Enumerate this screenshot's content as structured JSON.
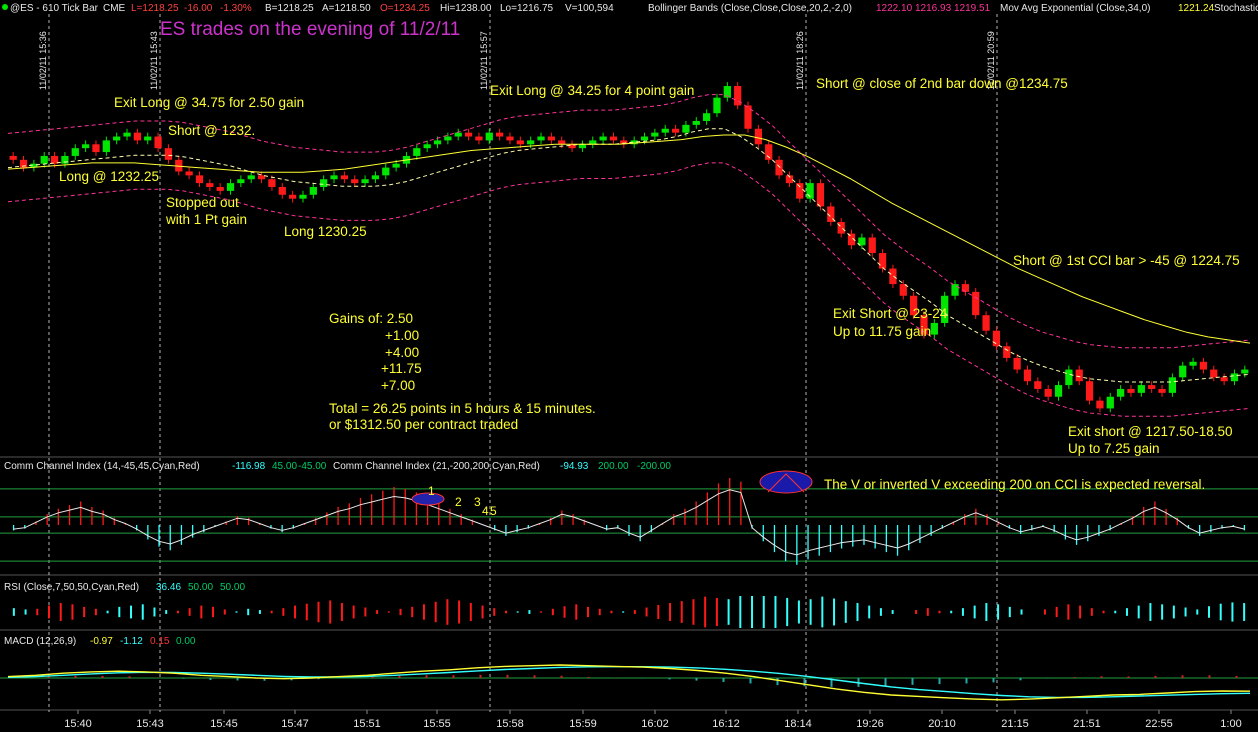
{
  "header": {
    "symbol": "@ES - 610 Tick Bar",
    "exchange": "CME",
    "last": "L=1218.25",
    "change": "-16.00",
    "change_pct": "-1.30%",
    "bid": "B=1218.25",
    "ask": "A=1218.50",
    "open": "O=1234.25",
    "high": "Hi=1238.00",
    "low": "Lo=1216.75",
    "volume": "V=100,594",
    "bb_label": "Bollinger Bands (Close,Close,Close,20,2,-2,0)",
    "bb_values": [
      "1222.10",
      "1216.93",
      "1219.51"
    ],
    "ema_label": "Mov Avg Exponential (Close,34,0)",
    "ema_value": "1221.24",
    "stoch_label": "Stochastic"
  },
  "colors": {
    "up": "#00e600",
    "down": "#ff1a1a",
    "bb": "#ff3399",
    "ema": "#ffff33",
    "cyan": "#33ffff",
    "orange": "#ffcc00",
    "magenta": "#ff33cc"
  },
  "chart_data": [
    {
      "type": "candlestick",
      "title": "ES trades on the evening of 11/2/11",
      "series_name": "@ES 610 Tick Bar",
      "ylim": [
        1214,
        1242
      ],
      "x_tick_labels": [
        "15:40",
        "15:43",
        "15:45",
        "15:47",
        "15:51",
        "15:55",
        "15:58",
        "15:59",
        "16:02",
        "16:12",
        "18:14",
        "19:26",
        "20:10",
        "21:15",
        "21:51",
        "22:55",
        "1:00"
      ],
      "separator_dates": [
        "11/02/11 15:36",
        "11/02/11 15:43",
        "11/02/11 15:57",
        "11/02/11 18:26",
        "11/02/11 20:59"
      ],
      "close": [
        1233.0,
        1232.5,
        1232.75,
        1233.25,
        1232.75,
        1233.25,
        1233.75,
        1234.0,
        1233.5,
        1234.25,
        1234.5,
        1234.75,
        1234.25,
        1234.5,
        1233.75,
        1233.0,
        1232.25,
        1232.0,
        1231.5,
        1231.25,
        1231.0,
        1231.5,
        1231.75,
        1232.0,
        1231.75,
        1231.25,
        1230.75,
        1230.5,
        1230.75,
        1231.25,
        1231.75,
        1232.0,
        1231.75,
        1231.5,
        1231.75,
        1232.0,
        1232.5,
        1232.75,
        1233.25,
        1233.75,
        1234.0,
        1234.25,
        1234.5,
        1234.75,
        1234.5,
        1234.25,
        1234.75,
        1234.5,
        1234.25,
        1234.0,
        1234.25,
        1234.5,
        1234.25,
        1234.0,
        1233.75,
        1234.0,
        1234.25,
        1234.5,
        1234.25,
        1234.0,
        1234.25,
        1234.5,
        1234.75,
        1235.0,
        1234.75,
        1235.25,
        1235.5,
        1236.0,
        1237.0,
        1237.75,
        1236.5,
        1235.0,
        1234.0,
        1233.0,
        1232.0,
        1231.5,
        1230.5,
        1231.5,
        1230.0,
        1229.0,
        1228.25,
        1227.5,
        1228.0,
        1227.0,
        1226.0,
        1225.0,
        1224.25,
        1223.0,
        1221.75,
        1222.5,
        1224.25,
        1225.0,
        1224.5,
        1223.0,
        1222.0,
        1221.0,
        1220.25,
        1219.5,
        1218.75,
        1218.25,
        1217.75,
        1218.5,
        1219.5,
        1218.75,
        1217.5,
        1217.0,
        1217.75,
        1218.25,
        1218.0,
        1218.5,
        1218.25,
        1218.0,
        1219.0,
        1219.75,
        1220.0,
        1219.5,
        1219.0,
        1218.75,
        1219.25,
        1219.5
      ],
      "bollinger_basis": [
        1232.5,
        1232.6,
        1232.7,
        1232.8,
        1232.9,
        1233.0,
        1233.1,
        1233.2,
        1233.3,
        1233.3,
        1233.3,
        1233.2,
        1233.0,
        1232.8,
        1232.6,
        1232.3,
        1232.0,
        1231.8,
        1231.6,
        1231.5,
        1231.4,
        1231.3,
        1231.3,
        1231.3,
        1231.4,
        1231.6,
        1231.9,
        1232.2,
        1232.5,
        1232.8,
        1233.1,
        1233.4,
        1233.6,
        1233.7,
        1233.8,
        1233.9,
        1234.0,
        1234.0,
        1234.0,
        1234.1,
        1234.2,
        1234.3,
        1234.5,
        1234.8,
        1235.0,
        1235.0,
        1234.5,
        1233.8,
        1233.0,
        1232.0,
        1231.0,
        1230.0,
        1229.0,
        1228.0,
        1227.0,
        1226.0,
        1225.2,
        1224.5,
        1223.8,
        1223.0,
        1222.4,
        1221.8,
        1221.2,
        1220.6,
        1220.1,
        1219.7,
        1219.4,
        1219.1,
        1218.9,
        1218.8,
        1218.7,
        1218.7,
        1218.7,
        1218.7,
        1218.8,
        1218.9,
        1219.0,
        1219.1,
        1219.2
      ],
      "ema34": [
        1232.4,
        1232.5,
        1232.6,
        1232.7,
        1232.8,
        1232.8,
        1232.8,
        1232.7,
        1232.6,
        1232.5,
        1232.4,
        1232.3,
        1232.2,
        1232.2,
        1232.2,
        1232.3,
        1232.4,
        1232.6,
        1232.8,
        1233.0,
        1233.2,
        1233.4,
        1233.6,
        1233.7,
        1233.8,
        1233.9,
        1234.0,
        1234.0,
        1234.0,
        1234.0,
        1234.1,
        1234.2,
        1234.3,
        1234.5,
        1234.6,
        1234.6,
        1234.3,
        1233.8,
        1233.2,
        1232.5,
        1231.8,
        1231.0,
        1230.2,
        1229.5,
        1228.8,
        1228.1,
        1227.4,
        1226.7,
        1226.0,
        1225.4,
        1224.8,
        1224.2,
        1223.7,
        1223.2,
        1222.7,
        1222.3,
        1221.9,
        1221.6,
        1221.4,
        1221.2
      ],
      "annotations": [
        {
          "text": "Exit Long @ 34.75 for 2.50 gain",
          "color": "#ffff33"
        },
        {
          "text": "Short @ 1232.",
          "color": "#ffff33"
        },
        {
          "text": "Long @ 1232.25",
          "color": "#ffff33"
        },
        {
          "text": "Stopped out",
          "color": "#ffff33"
        },
        {
          "text": "with 1 Pt gain",
          "color": "#ffff33"
        },
        {
          "text": "Long 1230.25",
          "color": "#ffff33"
        },
        {
          "text": "Exit Long @ 34.25 for 4 point gain",
          "color": "#ffff33"
        },
        {
          "text": "Short @ close of 2nd bar down @1234.75",
          "color": "#ffff33"
        },
        {
          "text": "Short @ 1st CCI bar > -45 @ 1224.75",
          "color": "#ffff33"
        },
        {
          "text": "Exit Short @ 23-24",
          "color": "#ffff33"
        },
        {
          "text": "Up to 11.75 gain",
          "color": "#ffff33"
        },
        {
          "text": "Exit short @ 1217.50-18.50",
          "color": "#ffff33"
        },
        {
          "text": "Up to 7.25 gain",
          "color": "#ffff33"
        },
        {
          "text": "Gains of:  2.50",
          "color": "#ffff33"
        },
        {
          "text": "+1.00",
          "color": "#ffff33"
        },
        {
          "text": "+4.00",
          "color": "#ffff33"
        },
        {
          "text": "+11.75",
          "color": "#ffff33"
        },
        {
          "text": "+7.00",
          "color": "#ffff33"
        },
        {
          "text": "Total  = 26.25 points in 5 hours & 15 minutes.",
          "color": "#ffff33"
        },
        {
          "text": "or $1312.50 per contract traded",
          "color": "#ffff33"
        }
      ]
    },
    {
      "type": "histogram",
      "panel": "CCI",
      "labels": [
        {
          "text": "Comm Channel Index (14,-45,45,Cyan,Red)",
          "color": "#e8e8e8"
        },
        {
          "text": "-116.98",
          "color": "#33ffff"
        },
        {
          "text": "45.00",
          "color": "#00cc66"
        },
        {
          "text": "-45.00",
          "color": "#00cc66"
        },
        {
          "text": "Comm Channel Index (21,-200,200,Cyan,Red)",
          "color": "#e8e8e8"
        },
        {
          "text": "-94.93",
          "color": "#33ffff"
        },
        {
          "text": "200.00",
          "color": "#00cc66"
        },
        {
          "text": "-200.00",
          "color": "#00cc66"
        }
      ],
      "levels": [
        200,
        45,
        -45,
        -200
      ],
      "ylim": [
        -260,
        260
      ],
      "annotation": "The V or inverted V exceeding 200 on CCI is expected reversal.",
      "count_labels": [
        "1",
        "2",
        "3",
        "4",
        "5"
      ],
      "values": [
        -30,
        -20,
        20,
        60,
        90,
        110,
        130,
        100,
        80,
        40,
        10,
        -30,
        -80,
        -120,
        -140,
        -110,
        -70,
        -40,
        -10,
        20,
        50,
        40,
        10,
        -20,
        -40,
        -20,
        10,
        40,
        70,
        100,
        120,
        150,
        170,
        190,
        210,
        200,
        180,
        150,
        120,
        90,
        60,
        30,
        0,
        -30,
        -60,
        -40,
        -20,
        10,
        40,
        80,
        60,
        30,
        0,
        -30,
        -20,
        -60,
        -90,
        -40,
        10,
        60,
        90,
        130,
        180,
        230,
        260,
        240,
        -20,
        -90,
        -150,
        -200,
        -220,
        -190,
        -170,
        -150,
        -130,
        -120,
        -110,
        -130,
        -150,
        -170,
        -140,
        -100,
        -60,
        -20,
        20,
        60,
        90,
        60,
        20,
        -20,
        -50,
        -30,
        -10,
        -40,
        -80,
        -110,
        -90,
        -60,
        -30,
        10,
        50,
        100,
        130,
        90,
        40,
        -20,
        -60,
        -40,
        -20,
        -10,
        -30
      ]
    },
    {
      "type": "histogram",
      "panel": "RSI",
      "labels": [
        {
          "text": "RSI (Close,7,50,50,Cyan,Red)",
          "color": "#e8e8e8"
        },
        {
          "text": "36.46",
          "color": "#33ffff"
        },
        {
          "text": "50.00",
          "color": "#00cc66"
        },
        {
          "text": "50.00",
          "color": "#00cc66"
        }
      ],
      "ylim": [
        0,
        100
      ],
      "values": [
        44,
        46,
        55,
        60,
        64,
        62,
        58,
        55,
        48,
        42,
        40,
        38,
        43,
        47,
        52,
        56,
        60,
        58,
        54,
        49,
        45,
        47,
        52,
        56,
        60,
        63,
        66,
        68,
        64,
        60,
        57,
        53,
        51,
        55,
        58,
        62,
        66,
        70,
        68,
        64,
        60,
        56,
        52,
        49,
        47,
        51,
        55,
        59,
        62,
        58,
        55,
        52,
        49,
        53,
        57,
        61,
        64,
        67,
        70,
        74,
        72,
        30,
        25,
        22,
        20,
        24,
        28,
        32,
        30,
        26,
        29,
        33,
        36,
        40,
        44,
        47,
        50,
        53,
        56,
        52,
        48,
        44,
        40,
        36,
        38,
        42,
        46,
        50,
        54,
        58,
        62,
        60,
        56,
        52,
        48,
        44,
        40,
        36,
        38,
        40,
        43,
        46,
        41,
        37,
        35,
        36
      ]
    },
    {
      "type": "line",
      "panel": "MACD",
      "labels": [
        {
          "text": "MACD (12,26,9)",
          "color": "#e8e8e8"
        },
        {
          "text": "-0.97",
          "color": "#ffff33"
        },
        {
          "text": "-1.12",
          "color": "#33ffff"
        },
        {
          "text": "0.15",
          "color": "#ff3333"
        },
        {
          "text": "0.00",
          "color": "#00cc66"
        }
      ],
      "ylim": [
        -2.2,
        2.2
      ],
      "macd": [
        0.1,
        0.2,
        0.35,
        0.45,
        0.5,
        0.45,
        0.35,
        0.2,
        0.1,
        0.0,
        -0.05,
        0.0,
        0.1,
        0.2,
        0.35,
        0.5,
        0.6,
        0.75,
        0.85,
        0.9,
        0.95,
        0.9,
        0.85,
        0.8,
        0.7,
        0.55,
        0.35,
        0.1,
        -0.2,
        -0.5,
        -0.8,
        -1.05,
        -1.25,
        -1.35,
        -1.45,
        -1.55,
        -1.6,
        -1.55,
        -1.45,
        -1.35,
        -1.25,
        -1.2,
        -1.1,
        -1.0,
        -0.95,
        -0.97
      ],
      "signal": [
        0.05,
        0.1,
        0.2,
        0.3,
        0.38,
        0.42,
        0.4,
        0.35,
        0.28,
        0.2,
        0.12,
        0.08,
        0.08,
        0.12,
        0.2,
        0.3,
        0.4,
        0.52,
        0.62,
        0.7,
        0.78,
        0.82,
        0.83,
        0.83,
        0.8,
        0.74,
        0.64,
        0.5,
        0.32,
        0.1,
        -0.15,
        -0.4,
        -0.65,
        -0.85,
        -1.0,
        -1.15,
        -1.28,
        -1.38,
        -1.42,
        -1.42,
        -1.38,
        -1.32,
        -1.26,
        -1.2,
        -1.15,
        -1.12
      ],
      "histogram": [
        0.05,
        0.1,
        0.15,
        0.15,
        0.12,
        0.03,
        -0.05,
        -0.15,
        -0.18,
        -0.2,
        -0.17,
        -0.08,
        0.02,
        0.08,
        0.15,
        0.2,
        0.2,
        0.23,
        0.23,
        0.2,
        0.17,
        0.08,
        0.02,
        -0.03,
        -0.1,
        -0.19,
        -0.29,
        -0.4,
        -0.52,
        -0.6,
        -0.65,
        -0.65,
        -0.6,
        -0.5,
        -0.45,
        -0.4,
        -0.32,
        -0.17,
        -0.03,
        0.07,
        0.13,
        0.12,
        0.16,
        0.2,
        0.2,
        0.15
      ]
    }
  ]
}
